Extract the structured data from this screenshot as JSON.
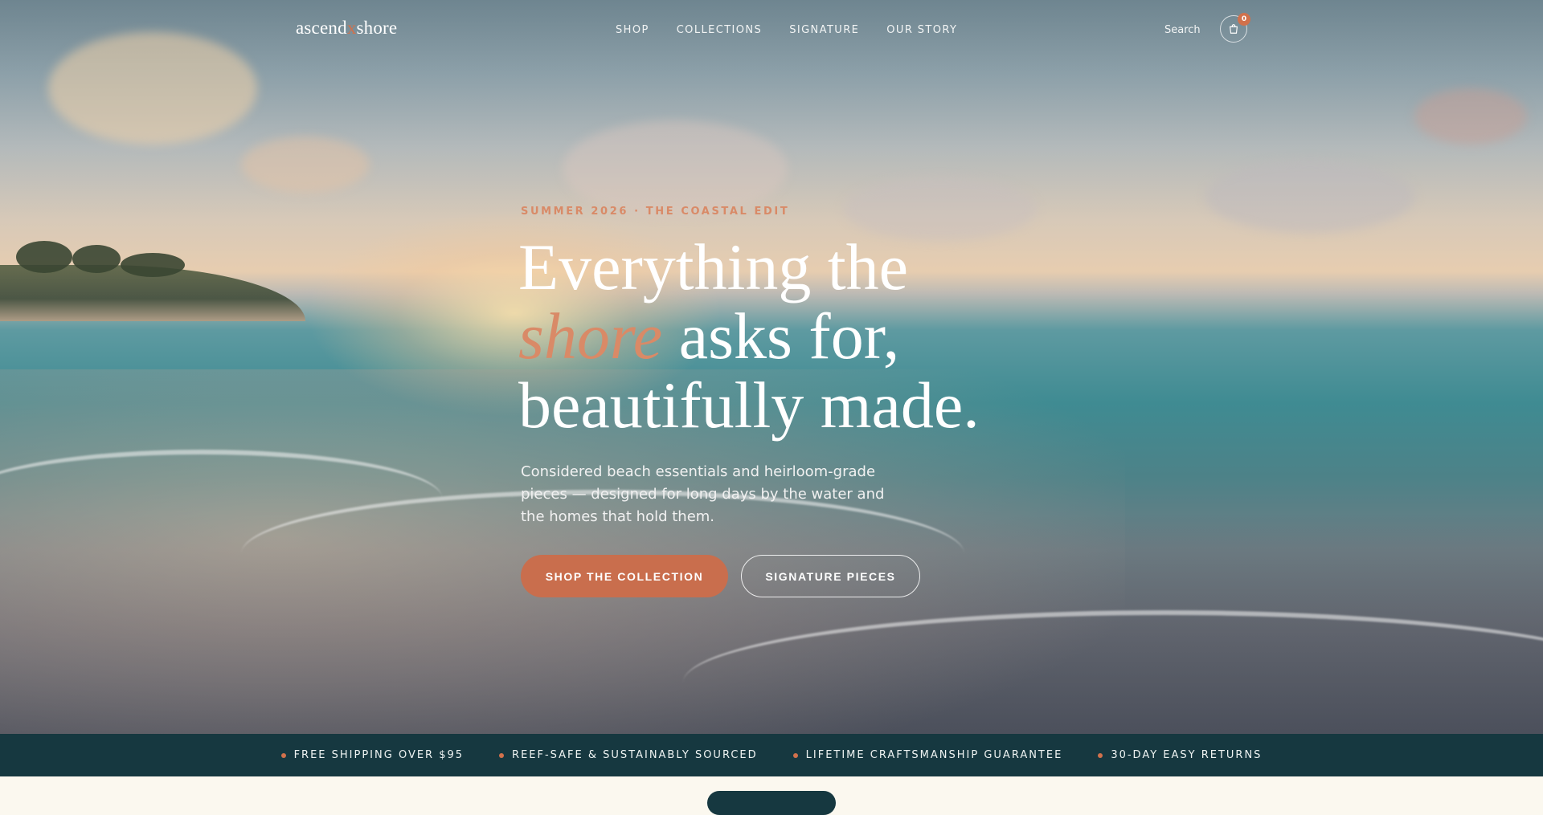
{
  "brand": {
    "part1": "ascend",
    "x": "x",
    "part2": "shore"
  },
  "nav": {
    "items": [
      "SHOP",
      "COLLECTIONS",
      "SIGNATURE",
      "OUR STORY"
    ],
    "search_label": "Search",
    "cart_count": "0"
  },
  "hero": {
    "eyebrow": "SUMMER 2026 · THE COASTAL EDIT",
    "headline_line1": "Everything the",
    "headline_accent": "shore",
    "headline_line2_rest": " asks for,",
    "headline_line3": "beautifully made.",
    "lede": "Considered beach essentials and heirloom-grade pieces — designed for long days by the water and the homes that hold them.",
    "primary_cta": "SHOP THE COLLECTION",
    "secondary_cta": "SIGNATURE PIECES"
  },
  "perks": [
    "FREE SHIPPING OVER $95",
    "REEF-SAFE & SUSTAINABLY SOURCED",
    "LIFETIME CRAFTSMANSHIP GUARANTEE",
    "30-DAY EASY RETURNS"
  ],
  "colors": {
    "accent": "#c96e4d",
    "accent_text": "#d98a67",
    "bar_bg": "#163840",
    "page_bg": "#fbf8ef"
  }
}
